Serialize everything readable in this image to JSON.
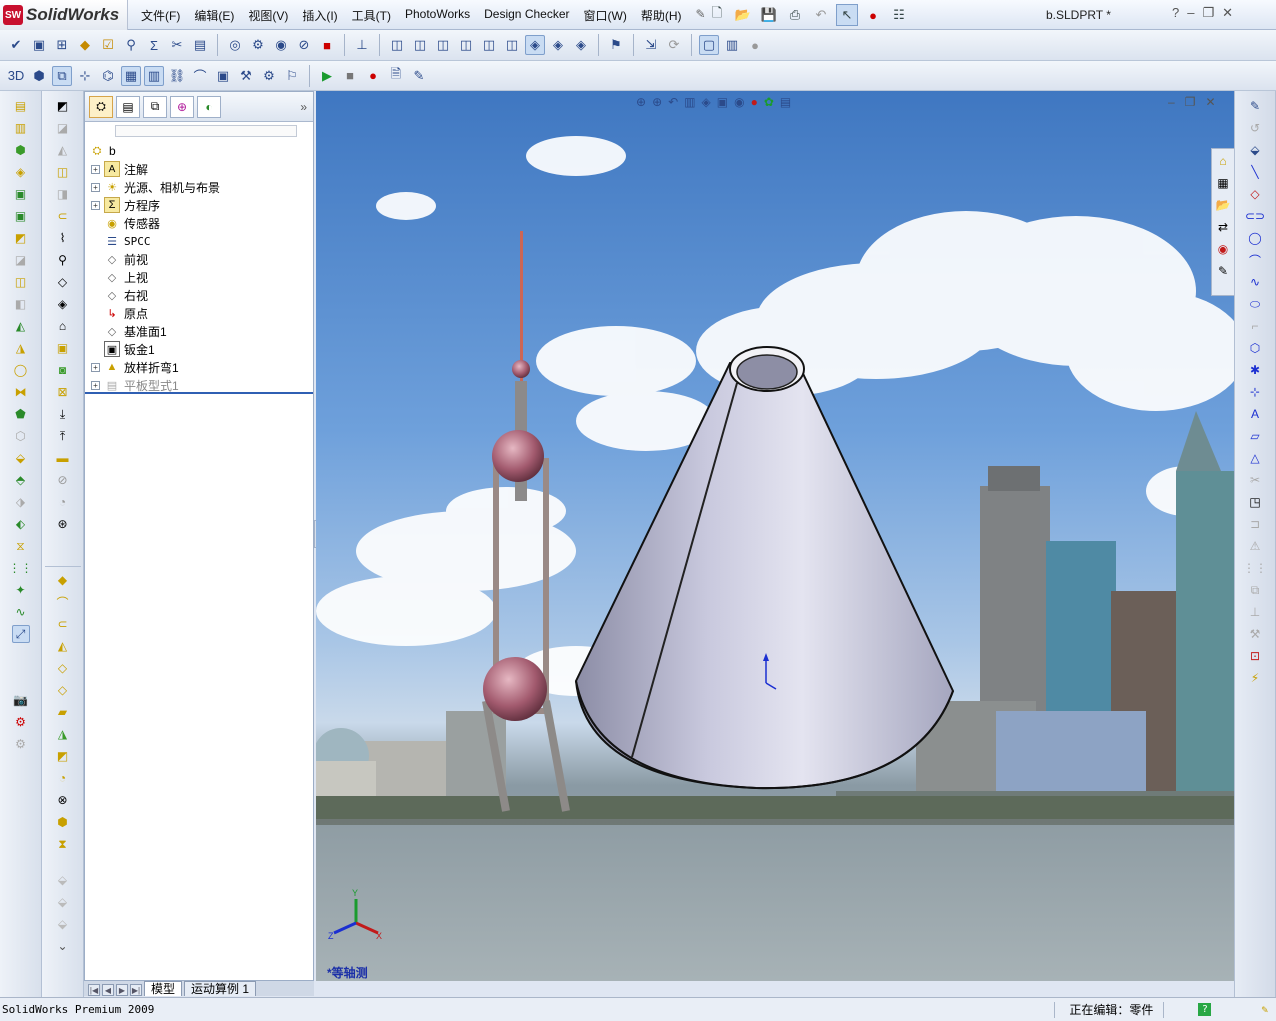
{
  "app": {
    "brand_prefix": "SW",
    "brand_name": "SolidWorks",
    "doc_title": "b.SLDPRT *"
  },
  "menu": [
    "文件(F)",
    "编辑(E)",
    "视图(V)",
    "插入(I)",
    "工具(T)",
    "PhotoWorks",
    "Design Checker",
    "窗口(W)",
    "帮助(H)"
  ],
  "window_controls": {
    "help": "?",
    "minimize": "–",
    "restore": "❐",
    "close": "✕"
  },
  "feature_manager": {
    "root": "b",
    "items": [
      {
        "label": "注解",
        "icon": "annotation-icon",
        "expandable": true
      },
      {
        "label": "光源、相机与布景",
        "icon": "lights-icon",
        "expandable": true
      },
      {
        "label": "方程序",
        "icon": "equation-icon",
        "expandable": true
      },
      {
        "label": "传感器",
        "icon": "sensor-icon",
        "expandable": false
      },
      {
        "label": "SPCC",
        "icon": "material-icon",
        "expandable": false
      },
      {
        "label": "前视",
        "icon": "plane-icon",
        "expandable": false
      },
      {
        "label": "上视",
        "icon": "plane-icon",
        "expandable": false
      },
      {
        "label": "右视",
        "icon": "plane-icon",
        "expandable": false
      },
      {
        "label": "原点",
        "icon": "origin-icon",
        "expandable": false
      },
      {
        "label": "基准面1",
        "icon": "plane-icon",
        "expandable": false
      },
      {
        "label": "钣金1",
        "icon": "sheetmetal-icon",
        "expandable": false
      },
      {
        "label": "放样折弯1",
        "icon": "lofted-bend-icon",
        "expandable": true
      },
      {
        "label": "平板型式1",
        "icon": "flat-pattern-icon",
        "expandable": true,
        "suppressed": true
      }
    ]
  },
  "bottom_tabs": [
    "模型",
    "运动算例 1"
  ],
  "viewport": {
    "view_label": "*等轴测",
    "triad": {
      "x": "X",
      "y": "Y",
      "z": "Z"
    }
  },
  "status": {
    "left": "SolidWorks Premium 2009",
    "editing": "正在编辑：零件"
  },
  "colors": {
    "accent": "#2f5fb3",
    "brand": "#c8102e",
    "sky": "#6ea0db",
    "water": "#9aa7ad"
  }
}
